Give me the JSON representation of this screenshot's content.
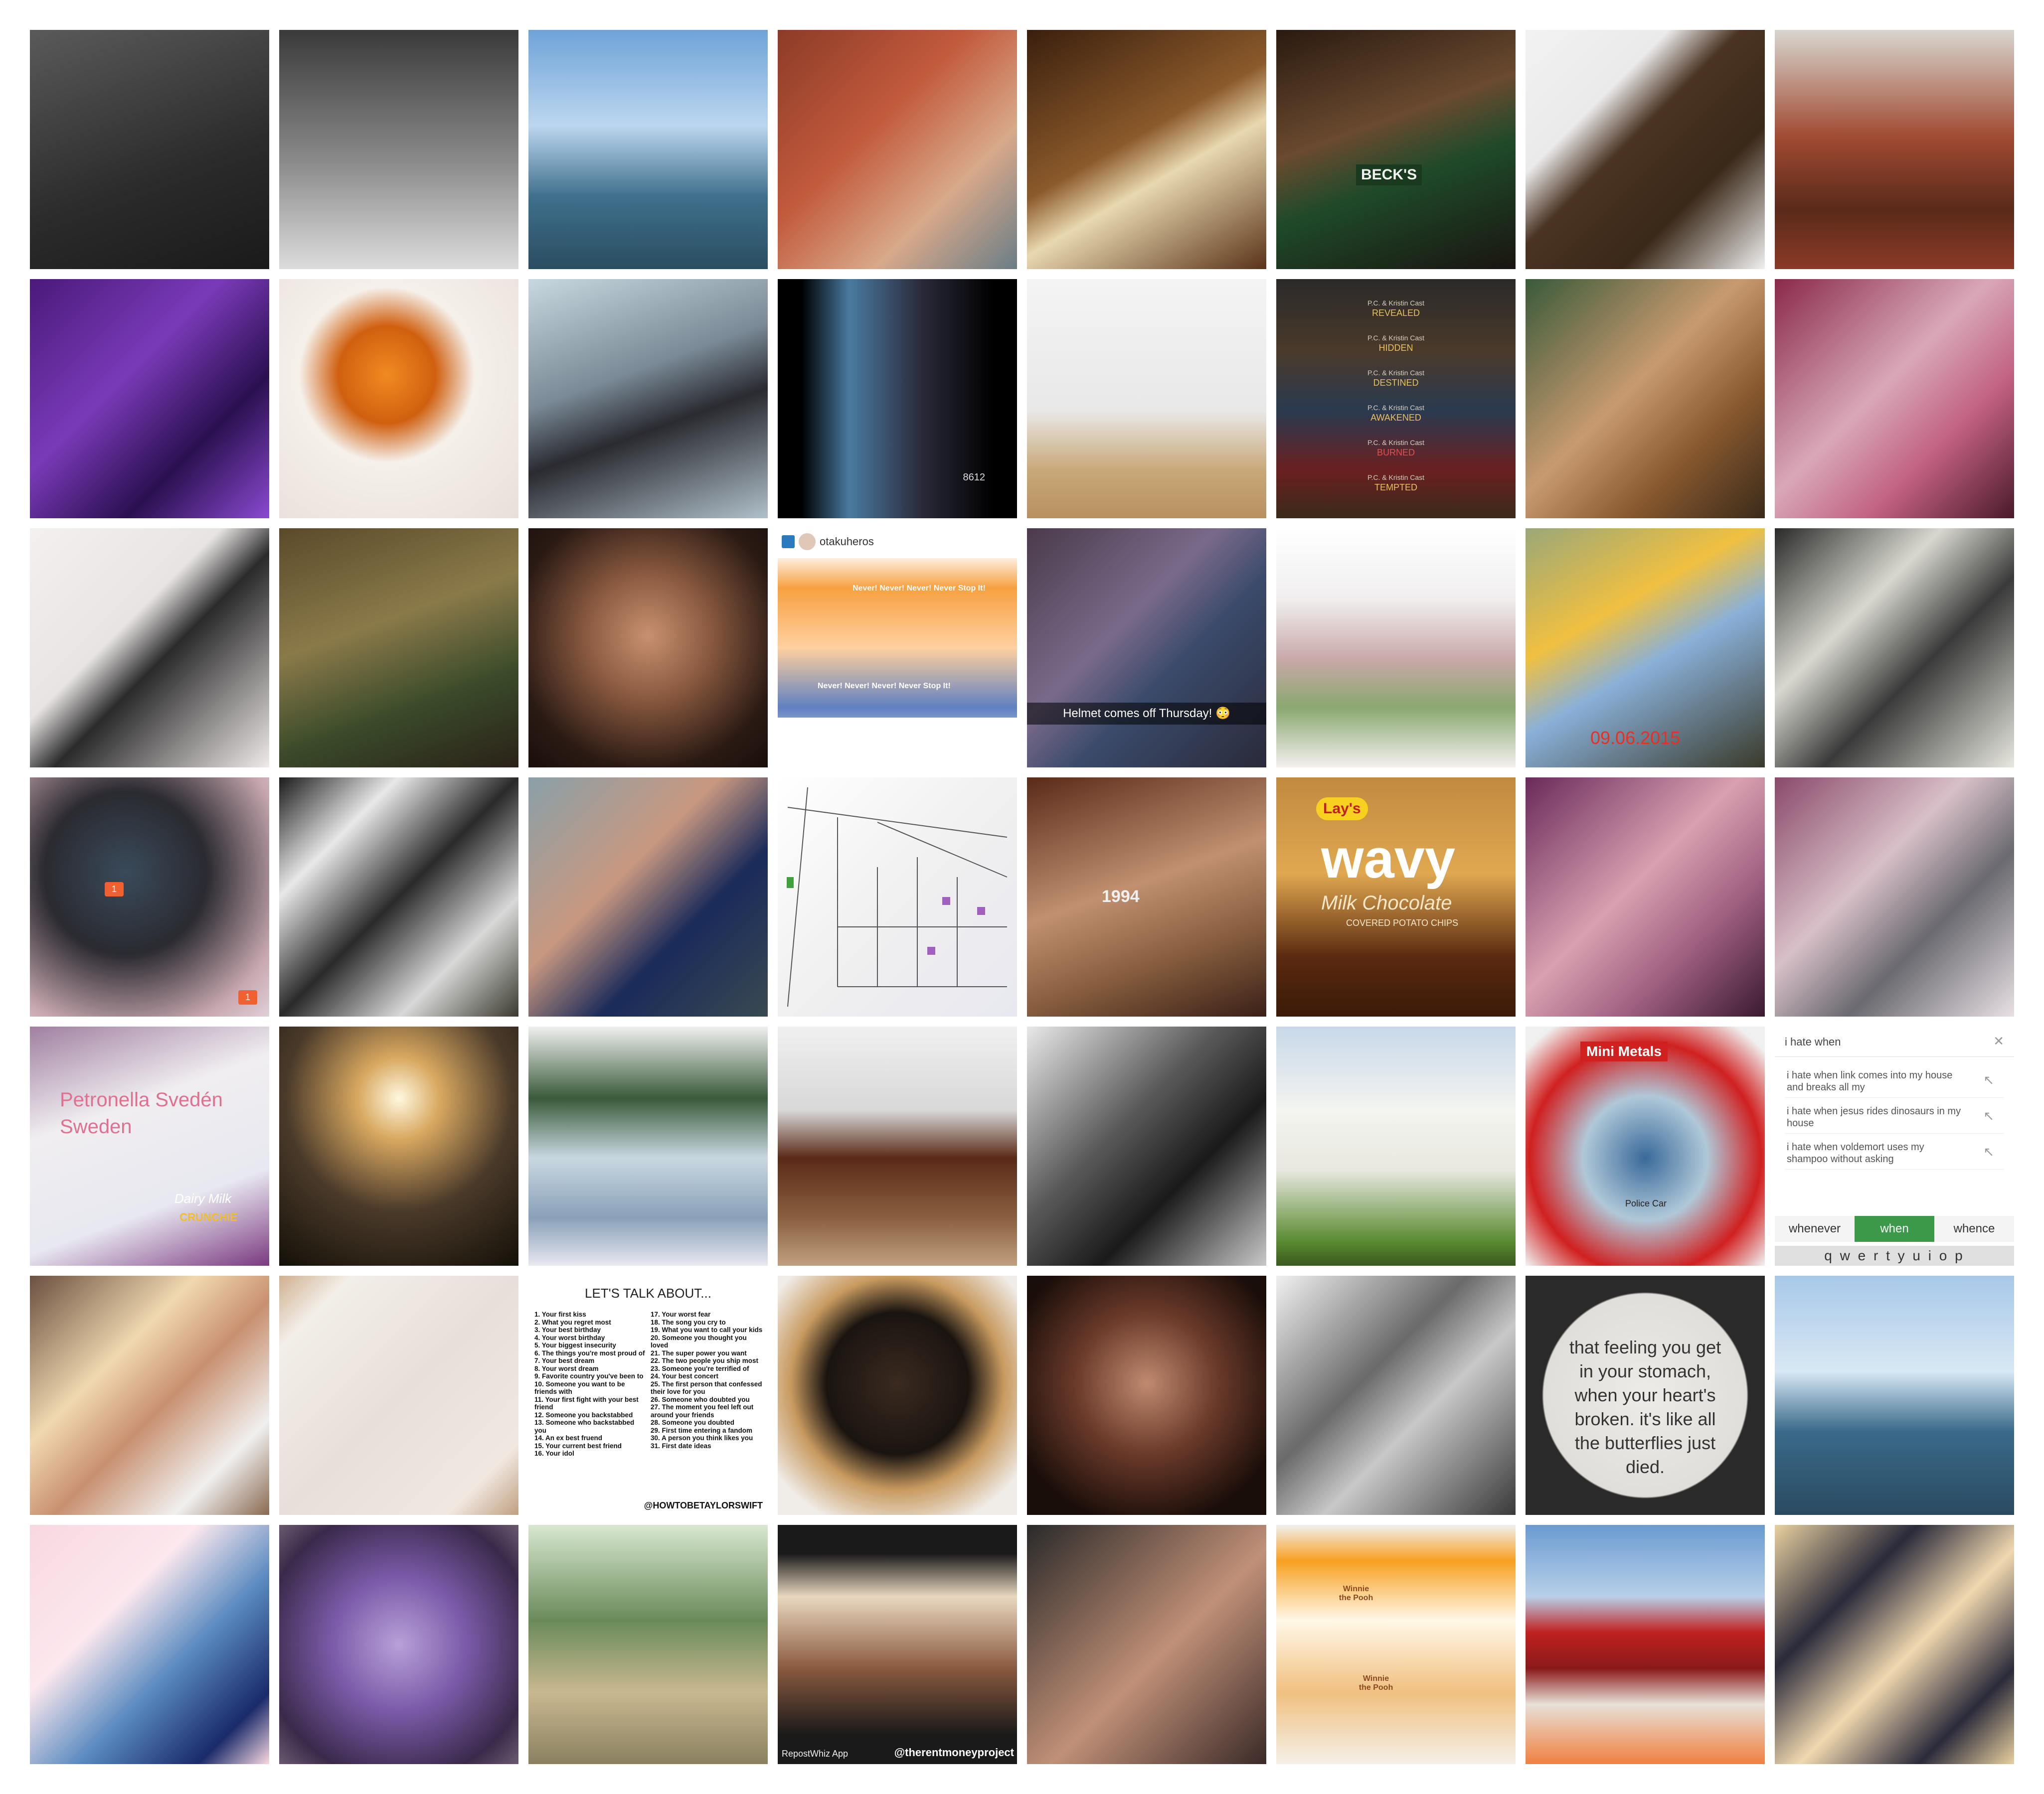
{
  "tiles": [
    {
      "id": "r0c0",
      "bg": "linear-gradient(160deg,#5a5a5a 0%,#2b2b2b 60%,#1a1a1a 100%)"
    },
    {
      "id": "r0c1",
      "bg": "linear-gradient(180deg,#3a3a3a 0%,#8a8a8a 55%,#dcdcdc 100%)"
    },
    {
      "id": "r0c2",
      "bg": "linear-gradient(180deg,#6fa3d8 0%,#bcd6ee 40%,#3f6f8c 70%,#2a4d60 100%)"
    },
    {
      "id": "r0c3",
      "bg": "linear-gradient(135deg,#8c3b28 0%,#c25a3c 40%,#d8a98a 70%,#6a7d86 100%)"
    },
    {
      "id": "r0c4",
      "bg": "linear-gradient(150deg,#3a1f0e 0%,#8b5a2b 45%,#e8d8b0 60%,#5a3318 100%)"
    },
    {
      "id": "r0c5",
      "bg": "linear-gradient(160deg,#2a1a10 0%,#6a4a30 40%,#1f4a2a 60%,#1a1410 100%)"
    },
    {
      "id": "r0c6",
      "bg": "linear-gradient(135deg,#f2f2f2 0%,#eaeaea 30%,#4a3322 45%,#3a2818 70%,#f0f0f0 100%)"
    },
    {
      "id": "r0c7",
      "bg": "linear-gradient(180deg,#d8d6d0 0%,#a04a32 45%,#5a2a1a 75%,#8a3a26 100%)"
    },
    {
      "id": "r1c0",
      "bg": "linear-gradient(135deg,#4a1a7a 0%,#7a3ab8 40%,#2a1050 70%,#8a4ad0 100%)"
    },
    {
      "id": "r1c1",
      "bg": "radial-gradient(circle at 45% 40%,#f08a20 0%,#d06010 25%,#f5f0ea 45%,#e8e0d8 100%)"
    },
    {
      "id": "r1c2",
      "bg": "linear-gradient(160deg,#c8d8e0 0%,#7a8a96 40%,#2a2a30 60%,#b0c0ca 100%)"
    },
    {
      "id": "r1c3",
      "bg": "linear-gradient(90deg,#000 0%,#000 10%,#4a7aa0 30%,#2a2a3a 60%,#000 90%)"
    },
    {
      "id": "r1c4",
      "bg": "linear-gradient(180deg,#f4f4f4 0%,#e8e8e8 55%,#c8a878 80%,#b89060 100%)"
    },
    {
      "id": "r1c5",
      "bg": "linear-gradient(180deg,#2a2a2a 0%,#4a3a2a 30%,#2a3a50 55%,#6a2020 80%,#3a2a1a 100%)"
    },
    {
      "id": "r1c6",
      "bg": "linear-gradient(135deg,#3a5a3a 0%,#c89a70 45%,#8a5a30 70%,#3a2a1a 100%)"
    },
    {
      "id": "r1c7",
      "bg": "linear-gradient(135deg,#8a2a4a 0%,#d8a8b8 45%,#c06080 70%,#4a1a2a 100%)"
    },
    {
      "id": "r2c0",
      "bg": "linear-gradient(135deg,#f4f0f0 0%,#e8e4e4 40%,#2a2a2a 55%,#f0eaea 100%)"
    },
    {
      "id": "r2c1",
      "bg": "linear-gradient(160deg,#5a4a2a 0%,#8a7a4a 40%,#3a4a2a 70%,#2a2218 100%)"
    },
    {
      "id": "r2c2",
      "bg": "radial-gradient(circle at 50% 45%,#c89070 0%,#8a5a40 35%,#2a1a14 75%,#1a0e0a 100%)"
    },
    {
      "id": "r2c3",
      "bg": "linear-gradient(180deg,#ffffff 0%,#ffffff 10%,#f7a040 25%,#ffd0a0 50%,#6080c0 75%,#ffffff 100%)"
    },
    {
      "id": "r2c4",
      "bg": "linear-gradient(135deg,#4a3a4a 0%,#7a6a8a 40%,#3a4a6a 60%,#2a2a3a 100%)"
    },
    {
      "id": "r2c5",
      "bg": "linear-gradient(180deg,#ffffff 0%,#f0eeee 30%,#c8a8a8 55%,#8aa870 75%,#f4f0f0 100%)"
    },
    {
      "id": "r2c6",
      "bg": "linear-gradient(150deg,#9aa878 0%,#f0c040 35%,#8ab0d8 55%,#3a3a2a 100%)"
    },
    {
      "id": "r2c7",
      "bg": "linear-gradient(135deg,#2a2a2a 0%,#d8d8d0 35%,#3a3a3a 60%,#e8e8e0 100%)"
    },
    {
      "id": "r3c0",
      "bg": "radial-gradient(circle at 40% 40%,#3a4a5a 0%,#2a2a30 40%,#c8a8b0 80%,#e0d0d8 100%)"
    },
    {
      "id": "r3c1",
      "bg": "linear-gradient(135deg,#1a1a1a 0%,#e8e8e8 25%,#2a2a2a 50%,#d8d8d8 75%,#3a3a30 100%)"
    },
    {
      "id": "r3c2",
      "bg": "linear-gradient(135deg,#8aa0a8 0%,#c89880 40%,#1a2a5a 65%,#3a4a50 100%)"
    },
    {
      "id": "r3c3",
      "bg": "linear-gradient(135deg,#ffffff 0%,#f0f0f0 50%,#e8e8f0 100%)"
    },
    {
      "id": "r3c4",
      "bg": "linear-gradient(160deg,#5a2a1a 0%,#c09070 45%,#8a6040 70%,#3a2018 100%)"
    },
    {
      "id": "r3c5",
      "bg": "linear-gradient(180deg,#c08a40 0%,#e0a850 40%,#5a2a10 75%,#3a1a08 100%)"
    },
    {
      "id": "r3c6",
      "bg": "linear-gradient(135deg,#6a2a5a 0%,#d8a0b0 45%,#a06080 70%,#3a1a30 100%)"
    },
    {
      "id": "r3c7",
      "bg": "linear-gradient(135deg,#8a4a6a 0%,#d8c0c8 40%,#6a6a70 65%,#e8e0e4 100%)"
    },
    {
      "id": "r4c0",
      "bg": "linear-gradient(160deg,#a080a0 0%,#f0eef0 35%,#e8e8f0 70%,#7a3a80 100%)"
    },
    {
      "id": "r4c1",
      "bg": "radial-gradient(circle at 50% 30%,#fff8e0 0%,#d8a860 20%,#4a3a2a 55%,#141008 100%)"
    },
    {
      "id": "r4c2",
      "bg": "linear-gradient(180deg,#f0f0f0 0%,#3a5a3a 30%,#c8d8e0 55%,#8aa0b8 80%,#e8e8f0 100%)"
    },
    {
      "id": "r4c3",
      "bg": "linear-gradient(180deg,#f0f0f0 0%,#d8d8d8 35%,#5a2a18 55%,#8a6040 80%,#c0a080 100%)"
    },
    {
      "id": "r4c4",
      "bg": "linear-gradient(135deg,#e8e8e8 0%,#5a5a5a 40%,#1a1a1a 65%,#c8c8c8 100%)"
    },
    {
      "id": "r4c5",
      "bg": "linear-gradient(180deg,#c8d8e8 0%,#f4f4f0 35%,#e8e8e0 60%,#5a8a30 90%,#3a5a20 100%)"
    },
    {
      "id": "r4c6",
      "bg": "radial-gradient(circle at 50% 55%,#3a6a9a 0%,#b0c8d8 35%,#d02020 65%,#f0f0f0 90%)"
    },
    {
      "id": "r4c7",
      "bg": "#ffffff"
    },
    {
      "id": "r5c0",
      "bg": "linear-gradient(135deg,#6a5040 0%,#f0d8b0 35%,#c89070 55%,#f0f0f0 80%,#8a6a50 100%)"
    },
    {
      "id": "r5c1",
      "bg": "linear-gradient(135deg,#d0b090 0%,#f2eee8 15%,#e8e0d8 50%,#f0e8e0 85%,#c0a080 100%)"
    },
    {
      "id": "r5c2",
      "bg": "#ffffff"
    },
    {
      "id": "r5c3",
      "bg": "radial-gradient(circle at 50% 45%,#3a2a20 0%,#1a1410 40%,#c89a60 60%,#f0ece8 85%)"
    },
    {
      "id": "r5c4",
      "bg": "radial-gradient(circle at 50% 45%,#c08a70 0%,#6a3a2a 40%,#1a0e0a 80%)"
    },
    {
      "id": "r5c5",
      "bg": "linear-gradient(135deg,#f0f0f0 0%,#6a6a6a 40%,#c8c8c8 60%,#3a3a3a 100%)"
    },
    {
      "id": "r5c6",
      "bg": "radial-gradient(circle at 50% 50%,#ecebe8 0%,#e0deda 60%,#2a2a2a 61%,#2a2a2a 100%)"
    },
    {
      "id": "r5c7",
      "bg": "linear-gradient(180deg,#a8c8e8 0%,#d8e8f4 40%,#3a6a8a 65%,#2a4a60 100%)"
    },
    {
      "id": "r6c0",
      "bg": "linear-gradient(135deg,#f8d8e0 0%,#fce8ee 35%,#5a8ac0 60%,#1a2a6a 85%,#f8d8e0 100%)"
    },
    {
      "id": "r6c1",
      "bg": "radial-gradient(circle at 50% 50%,#b8a0d8 0%,#7a5aa8 40%,#3a2a4a 80%,#6a5a70 100%)"
    },
    {
      "id": "r6c2",
      "bg": "linear-gradient(180deg,#d8e8d0 0%,#6a8a5a 40%,#c8b890 70%,#8a8060 100%)"
    },
    {
      "id": "r6c3",
      "bg": "linear-gradient(180deg,#1a1a1a 0%,#1a1a1a 12%,#e8d8c0 30%,#8a5a40 60%,#1a1a1a 88%)"
    },
    {
      "id": "r6c4",
      "bg": "linear-gradient(135deg,#2a2a2a 0%,#8a6a5a 35%,#c09078 55%,#3a2a28 100%)"
    },
    {
      "id": "r6c5",
      "bg": "linear-gradient(180deg,#f0f0f0 0%,#f8a020 15%,#fff8e8 40%,#f0c080 70%,#f4f0e8 100%)"
    },
    {
      "id": "r6c6",
      "bg": "linear-gradient(180deg,#6a9ad0 0%,#b8d0e8 30%,#c02020 45%,#8a1a1a 60%,#e8e0d8 75%,#f08040 100%)"
    },
    {
      "id": "r6c7",
      "bg": "linear-gradient(135deg,#e8d0a0 0%,#2a2a3a 30%,#f0d8b0 55%,#2a2a3a 80%,#e8d0a0 100%)"
    }
  ],
  "texts": {
    "r2c3_user": "otakuheros",
    "r2c3_banner_top": "Never! Never! Never! Never Stop It!",
    "r2c3_banner_bottom": "Never! Never! Never! Never Stop It!",
    "r2c4_caption": "Helmet comes off Thursday! 😳",
    "r2c6_date": "09.06.2015",
    "r3c0_badge1": "1",
    "r3c0_badge2": "1",
    "r3c4_shirt": "1994",
    "r3c5_brand": "Lay's",
    "r3c5_wavy": "wavy",
    "r3c5_flavor": "Milk Chocolate",
    "r3c5_sub": "COVERED POTATO CHIPS",
    "r1c3_tag": "8612",
    "r1c5_books": [
      "REVEALED",
      "HIDDEN",
      "DESTINED",
      "AWAKENED",
      "BURNED",
      "TEMPTED"
    ],
    "r1c5_author": "P.C. & Kristin Cast",
    "r0c5_beer": "BECK'S",
    "r4c0_env": "Petronella Svedén\nSweden",
    "r4c0_choc": "Dairy Milk",
    "r4c0_choc_sub": "CRUNCHIE",
    "r4c6_pack": "Mini Metals",
    "r4c6_car": "Police Car",
    "r4c7_query": "i hate when",
    "r4c7_sugg": [
      "i hate when link comes into my house and breaks all my",
      "i hate when jesus rides dinosaurs in my house",
      "i hate when voldemort uses my shampoo without asking"
    ],
    "r4c7_words": [
      "whenever",
      "when",
      "whence"
    ],
    "r4c7_keys": "q w e r t y u i o p",
    "r5c2_title": "LET'S TALK ABOUT...",
    "r5c2_left": "1. Your first kiss\n2. What you regret most\n3. Your best birthday\n4. Your worst birthday\n5. Your biggest insecurity\n6. The things you're most proud of\n7. Your best dream\n8. Your worst dream\n9. Favorite country you've been to\n10. Someone you want to be friends with\n11. Your first fight with your best friend\n12. Someone you backstabbed\n13. Someone who backstabbed you\n14. An ex best fruend\n15. Your current best friend\n16. Your idol",
    "r5c2_right": "17. Your worst fear\n18. The song you cry to\n19. What you want to call your kids\n20. Someone you thought you loved\n21. The super power you want\n22. The two people you ship most\n23. Someone you're terrified of\n24. Your best concert\n25. The first person that confessed their love for you\n26. Someone who doubted you\n27. The moment you feel left out around your friends\n28. Someone you doubted\n29. First time entering a fandom\n30. A person you think likes you\n31. First date ideas",
    "r5c2_handle": "@HOWTOBETAYLORSWIFT",
    "r5c6_quote": "that feeling you get in your stomach, when your heart's broken. it's like all the butterflies just died.",
    "r6c3_app": "RepostWhiz App",
    "r6c3_handle": "@therentmoneyproject",
    "r6c5_bib1": "Winnie the Pooh",
    "r6c5_bib2": "Winnie the Pooh"
  }
}
